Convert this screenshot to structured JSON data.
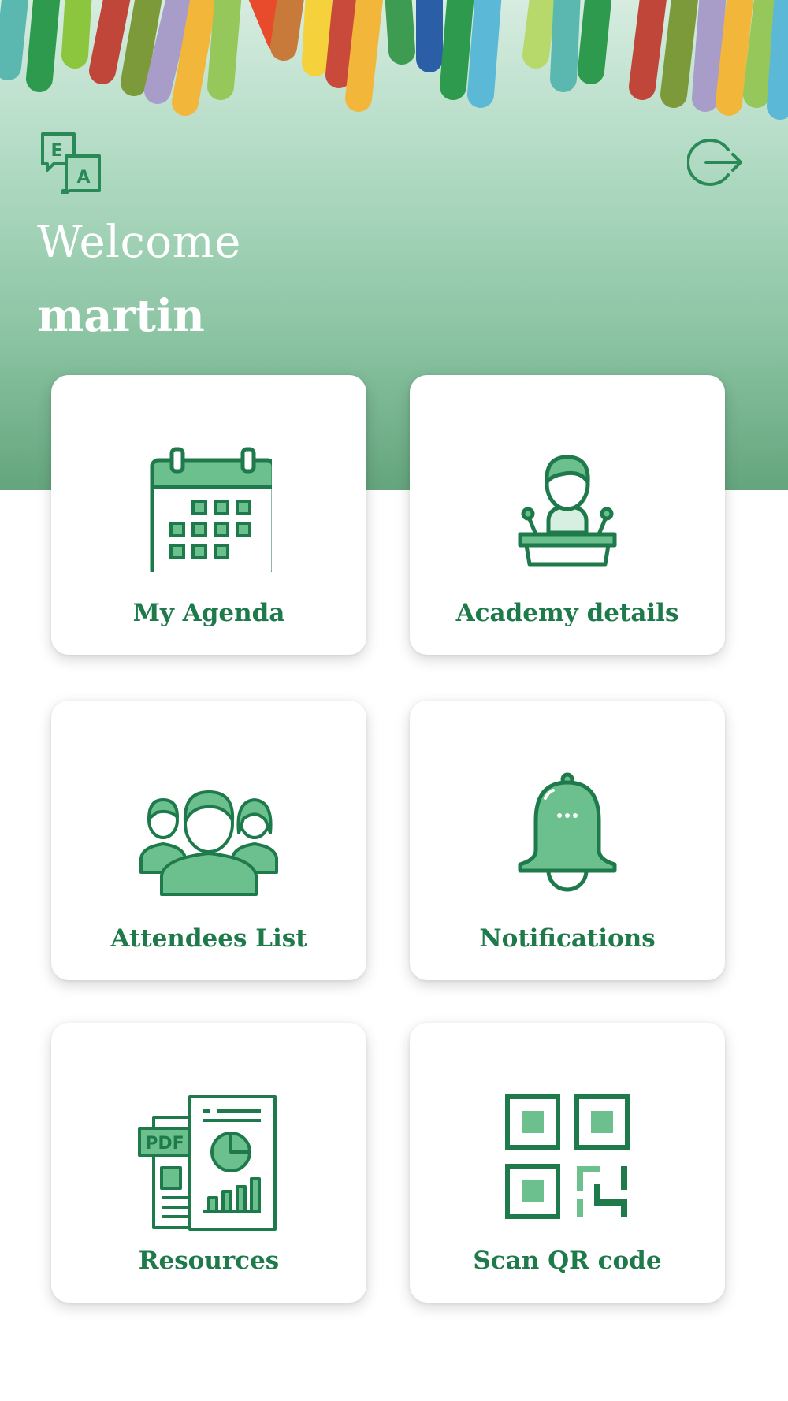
{
  "header": {
    "welcome": "Welcome",
    "username": "martin",
    "language_icon": "language-translate-icon",
    "logout_icon": "logout-icon"
  },
  "colors": {
    "primary": "#1e7a4b",
    "accent_light": "#6cc08e",
    "header_top": "#d6ece0",
    "header_bottom": "#64a57d"
  },
  "menu": [
    {
      "label": "My Agenda",
      "icon": "calendar-icon"
    },
    {
      "label": "Academy details",
      "icon": "speaker-podium-icon"
    },
    {
      "label": "Attendees List",
      "icon": "group-people-icon"
    },
    {
      "label": "Notifications",
      "icon": "bell-icon"
    },
    {
      "label": "Resources",
      "icon": "documents-icon"
    },
    {
      "label": "Scan QR code",
      "icon": "qr-code-icon"
    }
  ]
}
